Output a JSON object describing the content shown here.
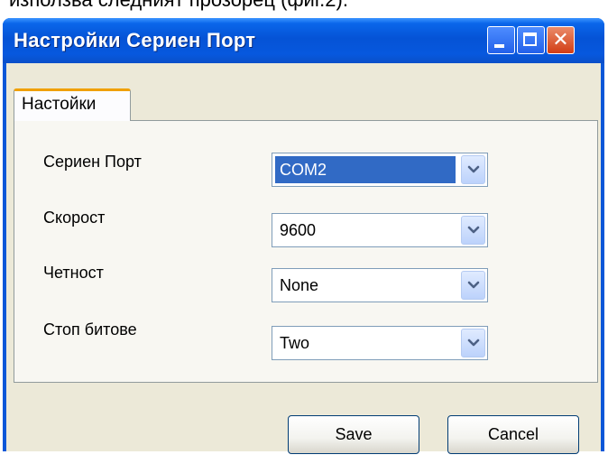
{
  "background_text": "използва следният прозорец (фиг.2).",
  "window": {
    "title": "Настройки Сериен Порт",
    "controls": {
      "minimize_icon": "minimize-icon",
      "maximize_icon": "maximize-icon",
      "close_icon": "close-icon",
      "close_glyph": "✕"
    }
  },
  "tabs": [
    {
      "label": "Настойки",
      "active": true
    }
  ],
  "fields": [
    {
      "label": "Сериен Порт",
      "value": "COM2",
      "selected": true
    },
    {
      "label": "Скорост",
      "value": "9600",
      "selected": false
    },
    {
      "label": "Четност",
      "value": "None",
      "selected": false
    },
    {
      "label": "Стоп битове",
      "value": "Two",
      "selected": false
    }
  ],
  "buttons": {
    "save_label": "Save",
    "cancel_label": "Cancel"
  },
  "colors": {
    "title_bar": "#0553d6",
    "client_bg": "#ece9d8",
    "selection": "#316ac5",
    "tab_highlight": "#f0a000",
    "close_button": "#d23d14"
  }
}
